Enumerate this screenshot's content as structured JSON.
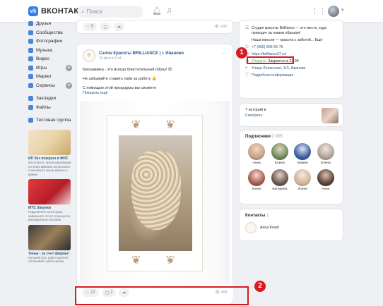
{
  "header": {
    "brand": "ВКОНТАКТЕ",
    "logo_letters": "vk",
    "search_placeholder": "Поиск"
  },
  "sidebar": {
    "items": [
      {
        "label": "Друзья"
      },
      {
        "label": "Сообщества"
      },
      {
        "label": "Фотографии"
      },
      {
        "label": "Музыка"
      },
      {
        "label": "Видео"
      },
      {
        "label": "Игры",
        "badge": "●"
      },
      {
        "label": "Маркет"
      },
      {
        "label": "Сервисы",
        "badge": "●"
      },
      {
        "label": "Закладки"
      },
      {
        "label": "Файлы"
      },
      {
        "label": "Тестовая группа"
      }
    ],
    "ads": [
      {
        "title": "ИП без похорон в ФНС",
        "text": "Бесплатно: прогнозирование по всем важным вопросам и сэкономите ваши деньги и время."
      },
      {
        "title": "МТС Закупки",
        "text": "Подключите категорию, завершите отчет в процессе расширенного вызова"
      },
      {
        "title": "Тиньк - за счет фирмы!",
        "text": "Лучший путь работодателя оплачивает работникам"
      }
    ]
  },
  "feed": {
    "top_reactions": {
      "likes": "5",
      "views": "295"
    },
    "post": {
      "avatar_text": "B",
      "author": "Салон Красоты BRILLIANCE | г. Иваново",
      "date": "10 фев в 9:34",
      "lines": [
        "Биозавивка - это всегда блистательный образ! 😍",
        "",
        "Не забывайте ставить лайк за работу 👍",
        "",
        "С помощью этой процедуры вы сможете"
      ],
      "show_more": "Показать ещё",
      "likes": "22",
      "comments": "2",
      "views": "495"
    }
  },
  "markers": {
    "one": "1",
    "two": "2"
  },
  "right": {
    "info": {
      "about": "Студия красоты Brilliance — это место, куда приходят за новым образом!",
      "about2": "Наша миссия — красота с заботой... Ещё",
      "phone": "+7 (960) 506-65-76",
      "site": "https://brilliance37.ru/",
      "open_status": "Открыто",
      "hours": "Закроется в 22:00",
      "address": "Улица Ленинская, 115, Иваново",
      "more": "Подробная информация"
    },
    "stories": {
      "line1": "7 историй в",
      "line2": "Смотреть"
    },
    "subscribers": {
      "title": "Подписчики",
      "count": "2 905",
      "people": [
        {
          "name": "Анна",
          "color": "#c9a38a"
        },
        {
          "name": "Елена",
          "color": "#6f8c5c"
        },
        {
          "name": "Мария",
          "color": "#3d5f9f"
        },
        {
          "name": "Елена",
          "color": "#b2a49a"
        },
        {
          "name": "Юлия",
          "color": "#a85d4e"
        },
        {
          "name": "Катерина",
          "color": "#6c5a52"
        },
        {
          "name": "Юлия",
          "color": "#d1b49b"
        },
        {
          "name": "Анна",
          "color": "#5c4336"
        }
      ]
    },
    "contacts": {
      "title": "Контакты",
      "count": "1",
      "name": "Anna Kravit"
    }
  },
  "colors": {
    "accent": "#2a5885",
    "highlight": "#d71a21",
    "brand": "#2f7fe6"
  }
}
